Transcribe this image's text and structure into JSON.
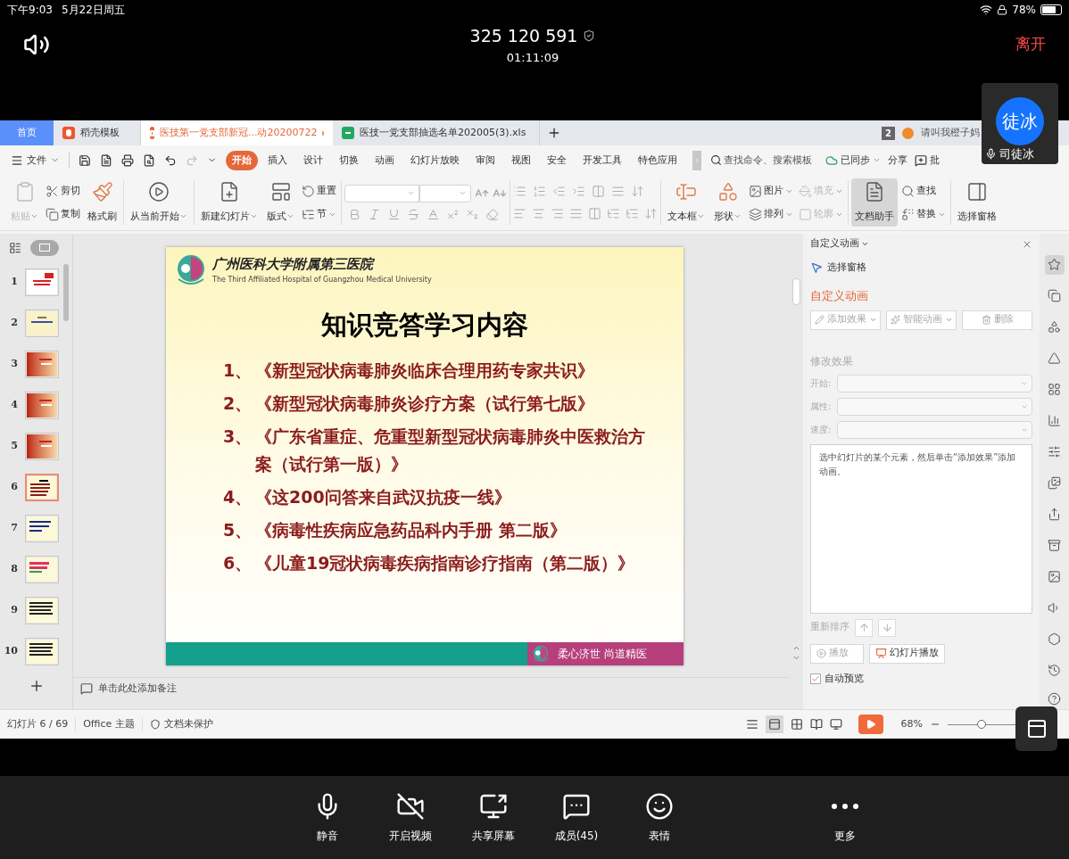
{
  "device_status": {
    "time": "下午9:03",
    "date": "5月22日周五",
    "battery": "78%"
  },
  "meeting": {
    "id": "325 120 591",
    "duration": "01:11:09",
    "leave": "离开"
  },
  "video_tile": {
    "avatar_text": "徒冰",
    "name": "司徒冰"
  },
  "app_tabs": [
    {
      "label": "首页",
      "kind": "home",
      "selected": false
    },
    {
      "label": "稻壳模板",
      "kind": "docer",
      "selected": false
    },
    {
      "label": "医技第一党支部新冠...动20200722",
      "kind": "ppt",
      "selected": true,
      "unsaved": true
    },
    {
      "label": "医技一党支部抽选名单202005(3).xls",
      "kind": "xls",
      "selected": false,
      "unsaved": false
    }
  ],
  "window_count": "2",
  "user_name": "请叫我橙子妈",
  "file_menu": "文件",
  "menu_tabs": [
    {
      "label": "开始",
      "selected": true
    },
    {
      "label": "插入",
      "selected": false
    },
    {
      "label": "设计",
      "selected": false
    },
    {
      "label": "切换",
      "selected": false
    },
    {
      "label": "动画",
      "selected": false
    },
    {
      "label": "幻灯片放映",
      "selected": false
    },
    {
      "label": "审阅",
      "selected": false
    },
    {
      "label": "视图",
      "selected": false
    },
    {
      "label": "安全",
      "selected": false
    },
    {
      "label": "开发工具",
      "selected": false
    },
    {
      "label": "特色应用",
      "selected": false
    }
  ],
  "command_search": {
    "placeholder": "查找命令、搜索模板"
  },
  "menu_actions": [
    {
      "label": "已同步",
      "dropdown": true
    },
    {
      "label": "分享",
      "dropdown": false
    },
    {
      "label": "批",
      "dropdown": false
    }
  ],
  "ribbon": [
    {
      "columns": [
        [
          {
            "label": "粘贴",
            "disabled": true,
            "selected": false,
            "dropdown": true
          }
        ],
        [
          {
            "label": "剪切",
            "disabled": false,
            "selected": false,
            "dropdown": false
          },
          {
            "label": "复制",
            "disabled": false,
            "selected": false,
            "dropdown": false
          }
        ],
        [
          {
            "label": "格式刷",
            "disabled": false,
            "selected": false,
            "dropdown": false
          }
        ]
      ]
    },
    {
      "columns": [
        [
          {
            "label": "从当前开始",
            "disabled": false,
            "selected": false,
            "dropdown": true
          }
        ]
      ]
    },
    {
      "columns": [
        [
          {
            "label": "新建幻灯片",
            "disabled": false,
            "selected": false,
            "dropdown": true
          }
        ],
        [
          {
            "label": "版式",
            "disabled": false,
            "selected": false,
            "dropdown": true
          }
        ],
        [
          {
            "label": "重置",
            "disabled": false,
            "selected": false,
            "dropdown": false
          },
          {
            "label": "节",
            "disabled": false,
            "selected": false,
            "dropdown": true
          }
        ]
      ]
    },
    {
      "kind": "font"
    },
    {
      "kind": "paragraph"
    },
    {
      "columns": [
        [
          {
            "label": "文本框",
            "disabled": false,
            "selected": false,
            "dropdown": true
          }
        ],
        [
          {
            "label": "形状",
            "disabled": false,
            "selected": false,
            "dropdown": true
          }
        ],
        [
          {
            "label": "图片",
            "disabled": false,
            "selected": false,
            "dropdown": true
          },
          {
            "label": "排列",
            "disabled": false,
            "selected": false,
            "dropdown": true
          }
        ],
        [
          {
            "label": "填充",
            "disabled": true,
            "selected": false,
            "dropdown": true
          },
          {
            "label": "轮廓",
            "disabled": true,
            "selected": false,
            "dropdown": true
          }
        ]
      ]
    },
    {
      "columns": [
        [
          {
            "label": "文档助手",
            "disabled": false,
            "selected": true,
            "dropdown": false
          }
        ],
        [
          {
            "label": "查找",
            "disabled": false,
            "selected": false,
            "dropdown": false
          },
          {
            "label": "替换",
            "disabled": false,
            "selected": false,
            "dropdown": true
          }
        ]
      ]
    },
    {
      "columns": [
        [
          {
            "label": "选择窗格",
            "disabled": false,
            "selected": false,
            "dropdown": false
          }
        ]
      ]
    }
  ],
  "thumbnails": [
    {
      "number": "1",
      "kind": "title",
      "selected": false
    },
    {
      "number": "2",
      "kind": "plain",
      "selected": false
    },
    {
      "number": "3",
      "kind": "red",
      "selected": false
    },
    {
      "number": "4",
      "kind": "red",
      "selected": false
    },
    {
      "number": "5",
      "kind": "red",
      "selected": false
    },
    {
      "number": "6",
      "kind": "list",
      "selected": true
    },
    {
      "number": "7",
      "kind": "blue",
      "selected": false
    },
    {
      "number": "8",
      "kind": "green",
      "selected": false
    },
    {
      "number": "9",
      "kind": "text",
      "selected": false
    },
    {
      "number": "10",
      "kind": "text",
      "selected": false
    }
  ],
  "slide": {
    "hospital_name": "广州医科大学附属第三医院",
    "hospital_name_en": "The Third Affiliated Hospital of Guangzhou Medical University",
    "title": "知识竞答学习内容",
    "items": [
      {
        "number": "1、",
        "text": "《新型冠状病毒肺炎临床合理用药专家共识》"
      },
      {
        "number": "2、",
        "text": "《新型冠状病毒肺炎诊疗方案（试行第七版》"
      },
      {
        "number": "3、",
        "text": "《广东省重症、危重型新型冠状病毒肺炎中医救治方案（试行第一版）》"
      },
      {
        "number": "4、",
        "text": "《这200问答来自武汉抗疫一线》"
      },
      {
        "number": "5、",
        "text": "《病毒性疾病应急药品科内手册  第二版》"
      },
      {
        "number": "6、",
        "text": "《儿童19冠状病毒疾病指南诊疗指南（第二版）》"
      }
    ],
    "motto": "柔心济世 尚道精医"
  },
  "notes_placeholder": "单击此处添加备注",
  "pane": {
    "title": "自定义动画",
    "select_pane": "选择窗格",
    "heading": "自定义动画",
    "buttons": [
      {
        "label": "添加效果",
        "disabled": true,
        "dropdown": true
      },
      {
        "label": "智能动画",
        "disabled": true,
        "dropdown": true
      },
      {
        "label": "删除",
        "disabled": true,
        "dropdown": false
      }
    ],
    "modify_heading": "修改效果",
    "fields": [
      {
        "label": "开始:"
      },
      {
        "label": "属性:"
      },
      {
        "label": "速度:"
      }
    ],
    "hint": "选中幻灯片的某个元素，然后单击“添加效果”添加动画。",
    "reorder": "重新排序",
    "play_buttons": [
      {
        "label": "播放",
        "disabled": true
      },
      {
        "label": "幻灯片播放",
        "disabled": false
      }
    ],
    "auto_preview": {
      "label": "自动预览",
      "checked": true
    }
  },
  "side_icons": [
    {
      "selected": true
    },
    {
      "selected": false
    },
    {
      "selected": false
    },
    {
      "selected": false
    },
    {
      "selected": false
    },
    {
      "selected": false
    },
    {
      "selected": false
    },
    {
      "selected": false
    },
    {
      "selected": false
    },
    {
      "selected": false
    },
    {
      "selected": false
    },
    {
      "selected": false
    },
    {
      "selected": false
    },
    {
      "selected": false
    }
  ],
  "status_bar": {
    "slide_count": "幻灯片 6 / 69",
    "theme": "Office 主题",
    "protection": "文档未保护",
    "zoom": "68%",
    "zoom_level": {
      "level": 0.5
    }
  },
  "meeting_toolbar": [
    {
      "label": "静音",
      "kind": "mic"
    },
    {
      "label": "开启视频",
      "kind": "video_off"
    },
    {
      "label": "共享屏幕",
      "kind": "share"
    },
    {
      "label": "成员(45)",
      "kind": "members"
    },
    {
      "label": "表情",
      "kind": "emoji"
    },
    {
      "label": "更多",
      "kind": "more"
    }
  ]
}
